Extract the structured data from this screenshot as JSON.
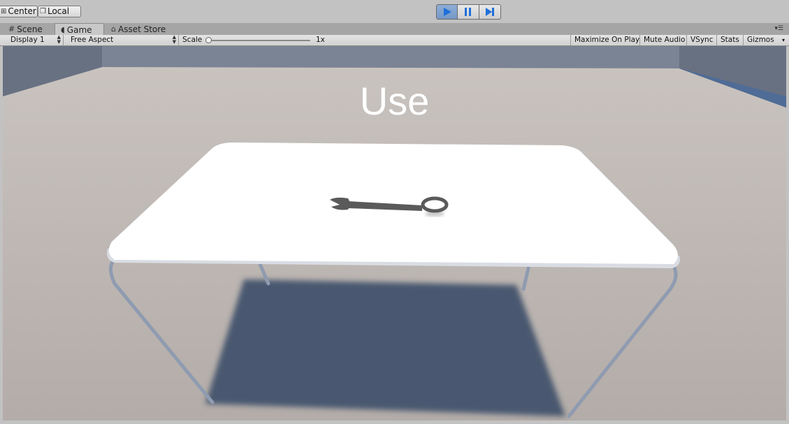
{
  "toolbar": {
    "pivot_label": "Center",
    "space_label": "Local",
    "play_icon": "play-icon",
    "pause_icon": "pause-icon",
    "step_icon": "step-icon",
    "play_active_color": "#1e6fd9"
  },
  "tabs": [
    {
      "label": "Scene",
      "icon": "grid-icon"
    },
    {
      "label": "Game",
      "icon": "pacman-icon"
    },
    {
      "label": "Asset Store",
      "icon": "store-icon"
    }
  ],
  "gamebar": {
    "display": "Display 1",
    "aspect": "Free Aspect",
    "scale_label": "Scale",
    "scale_value": "1x",
    "scale_fraction": 0,
    "maximize": "Maximize On Play",
    "mute": "Mute Audio",
    "vsync": "VSync",
    "stats": "Stats",
    "gizmos": "Gizmos"
  },
  "game_view": {
    "overlay_text": "Use",
    "floor_color": "#bfb7b3",
    "wall_color": "#6c7586",
    "shadow_color": "#4a5870",
    "table_color": "#ffffff",
    "legs_color": "#8f9bb0",
    "wrench_color": "#5a5a5a"
  }
}
